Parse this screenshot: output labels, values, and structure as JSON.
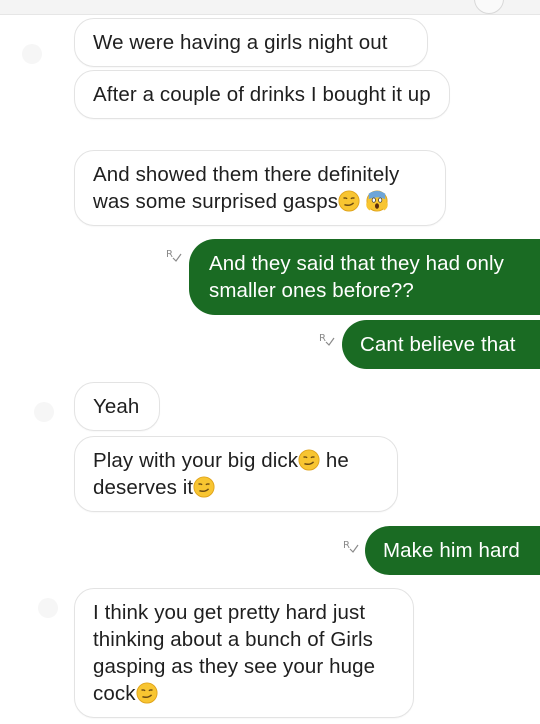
{
  "conversation": {
    "messages": [
      {
        "direction": "incoming",
        "text": "We were having a girls night out"
      },
      {
        "direction": "incoming",
        "text": "After a couple of drinks I bought it up"
      },
      {
        "direction": "incoming",
        "text": "And showed them there definitely was some surprised gasps",
        "emojis": [
          "smirking-face",
          "face-screaming-in-fear"
        ]
      },
      {
        "direction": "outgoing",
        "text": "And they said that they had only smaller ones before??",
        "receipt": "R"
      },
      {
        "direction": "outgoing",
        "text": "Cant believe that",
        "receipt": "R"
      },
      {
        "direction": "incoming",
        "text": "Yeah"
      },
      {
        "direction": "incoming",
        "text_part1": "Play with your big dick",
        "text_part2": " he deserves it",
        "emojis": [
          "smirking-face",
          "smirking-face"
        ]
      },
      {
        "direction": "outgoing",
        "text": "Make him hard",
        "receipt": "R"
      },
      {
        "direction": "incoming",
        "text": "I think you get pretty hard just thinking about a bunch of Girls gasping as they see your huge cock",
        "emojis": [
          "smirking-face"
        ]
      }
    ]
  },
  "colors": {
    "outgoing_bubble": "#1a6b23",
    "incoming_bubble": "#ffffff",
    "incoming_border": "#e3e3e3"
  }
}
